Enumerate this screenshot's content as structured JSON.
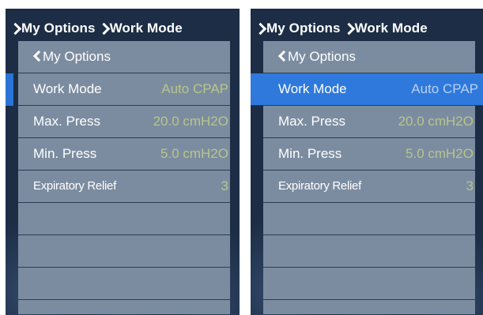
{
  "panels": [
    {
      "breadcrumb": {
        "parent": "My Options",
        "current": "Work Mode"
      },
      "back_label": "My Options",
      "rows": [
        {
          "label": "Work Mode",
          "value": "Auto CPAP"
        },
        {
          "label": "Max. Press",
          "value": "20.0 cmH2O"
        },
        {
          "label": "Min. Press",
          "value": "5.0 cmH2O"
        },
        {
          "label": "Expiratory Relief",
          "value": "3"
        }
      ],
      "selected_row": "Work Mode",
      "selection_style": "edge-marker"
    },
    {
      "breadcrumb": {
        "parent": "My Options",
        "current": "Work Mode"
      },
      "back_label": "My Options",
      "rows": [
        {
          "label": "Work Mode",
          "value": "Auto CPAP"
        },
        {
          "label": "Max. Press",
          "value": "20.0 cmH2O"
        },
        {
          "label": "Min. Press",
          "value": "5.0 cmH2O"
        },
        {
          "label": "Expiratory Relief",
          "value": "3"
        }
      ],
      "selected_row": "Work Mode",
      "selection_style": "full-highlight"
    }
  ],
  "colors": {
    "screen_bg": "#1c2d45",
    "list_bg": "#7c8ca0",
    "value_text": "#b7c68a",
    "highlight": "#2f79dc"
  }
}
